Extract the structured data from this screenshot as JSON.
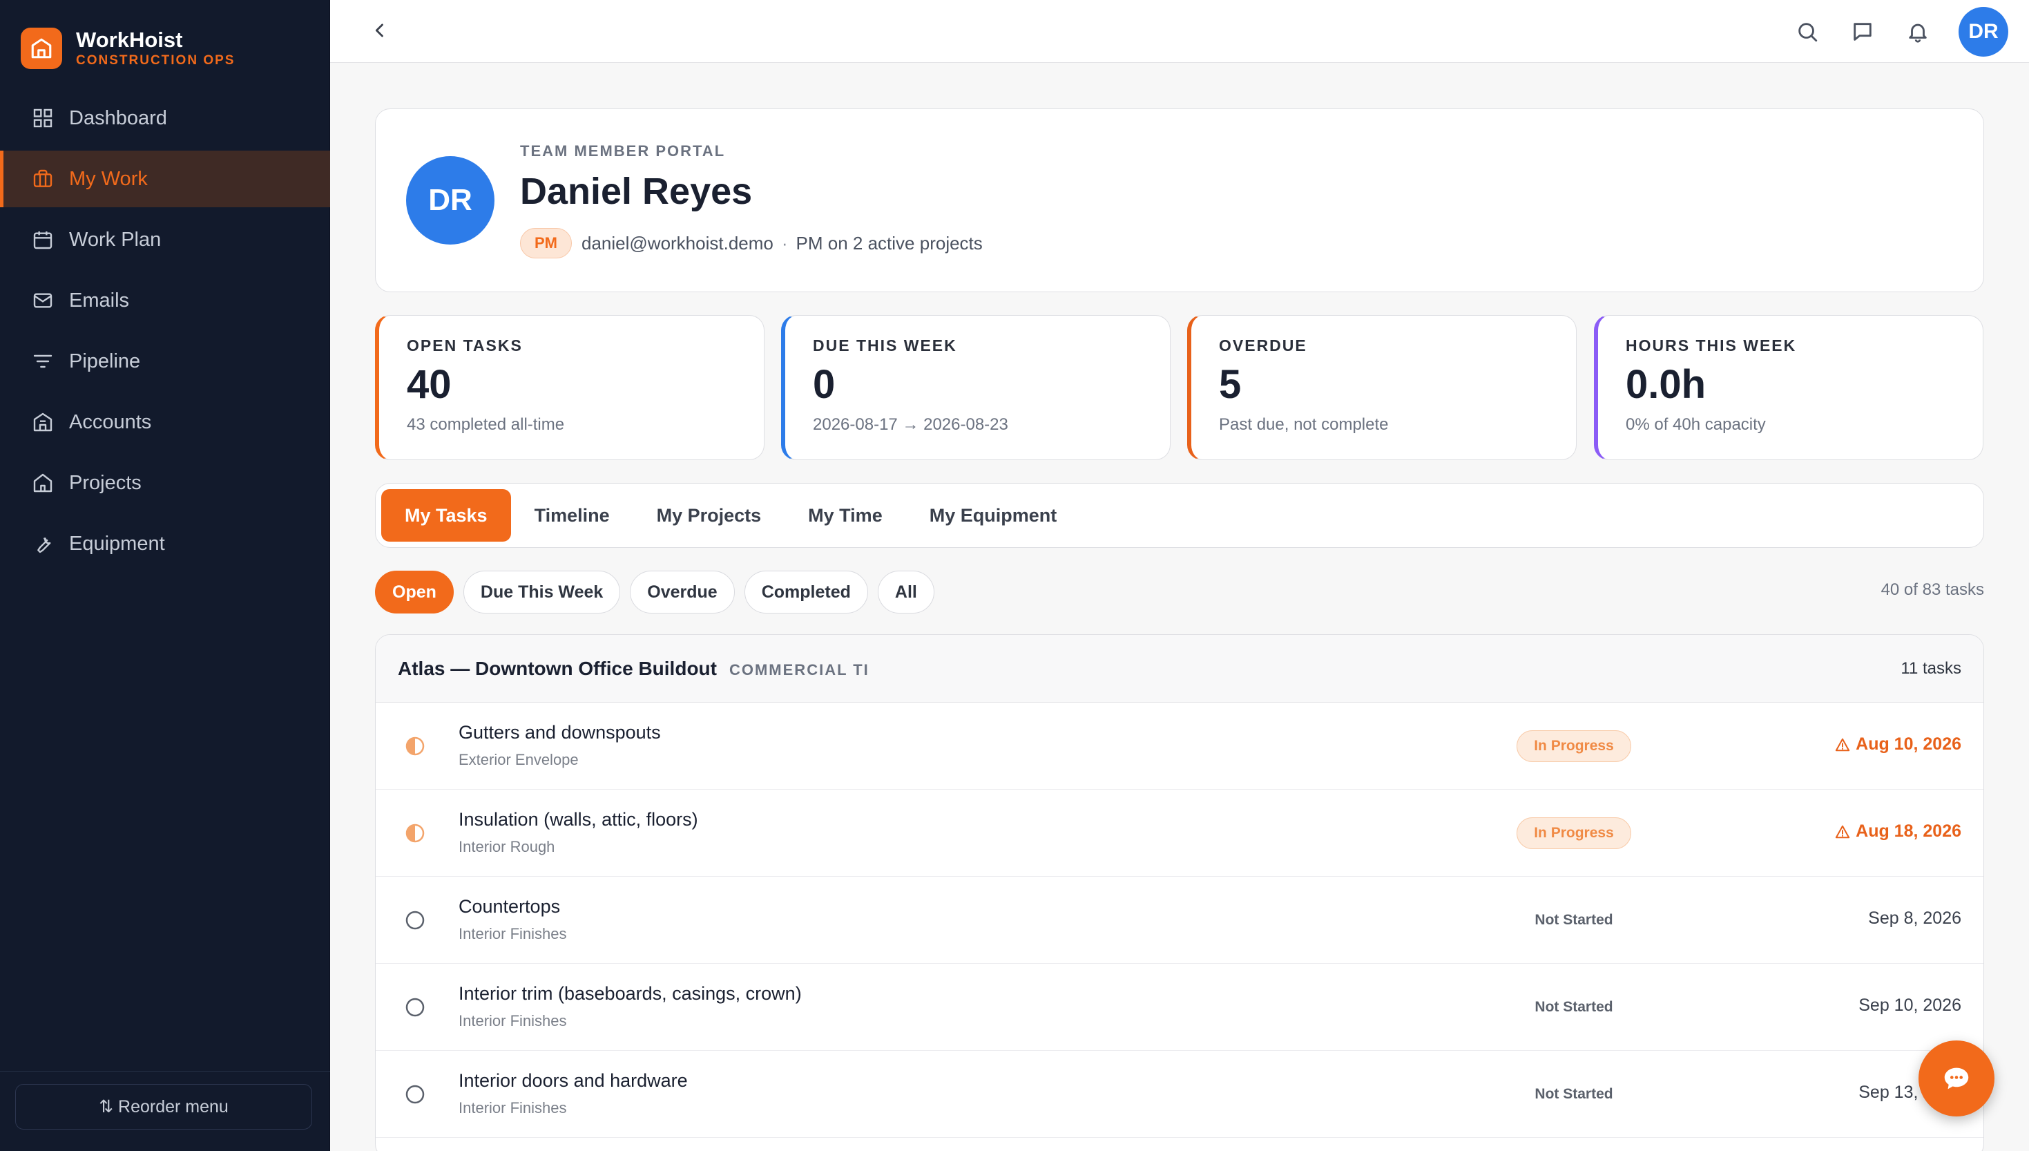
{
  "brand": {
    "name": "WorkHoist",
    "subtitle": "CONSTRUCTION OPS"
  },
  "sidebar": {
    "items": [
      {
        "label": "Dashboard",
        "icon": "grid-icon"
      },
      {
        "label": "My Work",
        "icon": "briefcase-icon",
        "active": true
      },
      {
        "label": "Work Plan",
        "icon": "calendar-icon"
      },
      {
        "label": "Emails",
        "icon": "mail-icon"
      },
      {
        "label": "Pipeline",
        "icon": "filter-icon"
      },
      {
        "label": "Accounts",
        "icon": "building-icon"
      },
      {
        "label": "Projects",
        "icon": "home-icon"
      },
      {
        "label": "Equipment",
        "icon": "wrench-icon"
      }
    ],
    "footer": {
      "reorder_label": "⇅ Reorder menu"
    }
  },
  "topbar": {
    "avatar_initials": "DR"
  },
  "profile": {
    "portal_label": "TEAM MEMBER PORTAL",
    "initials": "DR",
    "name": "Daniel Reyes",
    "role": "PM",
    "email": "daniel@workhoist.demo",
    "separator": "·",
    "summary": "PM on 2 active projects"
  },
  "stats": [
    {
      "label": "OPEN TASKS",
      "value": "40",
      "sub": "43 completed all-time",
      "color": "#f26a1b"
    },
    {
      "label": "DUE THIS WEEK",
      "value": "0",
      "sub": "2026-08-17 → 2026-08-23",
      "color": "#2d7ce9"
    },
    {
      "label": "OVERDUE",
      "value": "5",
      "sub": "Past due, not complete",
      "color": "#e8611a"
    },
    {
      "label": "HOURS THIS WEEK",
      "value": "0.0h",
      "sub": "0% of 40h capacity",
      "color": "#8b5cf6"
    }
  ],
  "tabs": [
    "My Tasks",
    "Timeline",
    "My Projects",
    "My Time",
    "My Equipment"
  ],
  "filters": [
    "Open",
    "Due This Week",
    "Overdue",
    "Completed",
    "All"
  ],
  "task_count": "40 of 83 tasks",
  "group": {
    "title": "Atlas — Downtown Office Buildout",
    "tag": "COMMERCIAL TI",
    "count": "11 tasks",
    "tasks": [
      {
        "name": "Gutters and downspouts",
        "phase": "Exterior Envelope",
        "status": "In Progress",
        "due": "Aug 10, 2026",
        "late": true
      },
      {
        "name": "Insulation (walls, attic, floors)",
        "phase": "Interior Rough",
        "status": "In Progress",
        "due": "Aug 18, 2026",
        "late": true
      },
      {
        "name": "Countertops",
        "phase": "Interior Finishes",
        "status": "Not Started",
        "due": "Sep 8, 2026",
        "late": false
      },
      {
        "name": "Interior trim (baseboards, casings, crown)",
        "phase": "Interior Finishes",
        "status": "Not Started",
        "due": "Sep 10, 2026",
        "late": false
      },
      {
        "name": "Interior doors and hardware",
        "phase": "Interior Finishes",
        "status": "Not Started",
        "due": "Sep 13, 2026",
        "late": false
      }
    ]
  },
  "colors": {
    "accent": "#f26a1b",
    "sidebar_bg": "#121a2c",
    "avatar": "#2d7ce9"
  }
}
